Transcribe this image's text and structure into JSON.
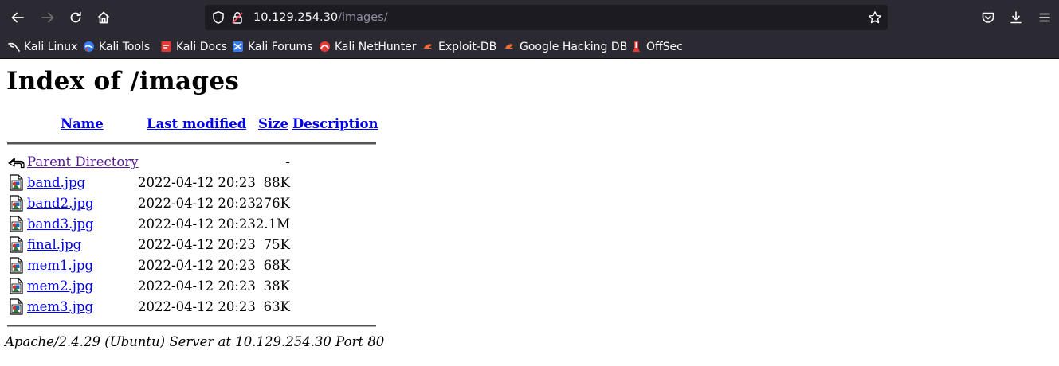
{
  "browser": {
    "url_host": "10.129.254.30",
    "url_path": "/images/",
    "bookmarks": [
      {
        "label": "Kali Linux",
        "icon": "kali-dragon-icon"
      },
      {
        "label": "Kali Tools",
        "icon": "kali-tools-icon"
      },
      {
        "label": "Kali Docs",
        "icon": "kali-docs-icon"
      },
      {
        "label": "Kali Forums",
        "icon": "kali-forums-icon"
      },
      {
        "label": "Kali NetHunter",
        "icon": "nethunter-icon"
      },
      {
        "label": "Exploit-DB",
        "icon": "exploit-db-icon"
      },
      {
        "label": "Google Hacking DB",
        "icon": "ghdb-icon"
      },
      {
        "label": "OffSec",
        "icon": "offsec-icon"
      }
    ]
  },
  "page": {
    "title": "Index of /images",
    "columns": {
      "name": "Name",
      "last_modified": "Last modified",
      "size": "Size",
      "description": "Description"
    },
    "parent": {
      "name": "Parent Directory",
      "size": "-"
    },
    "files": [
      {
        "name": "band.jpg",
        "modified": "2022-04-12 20:23",
        "size": "88K"
      },
      {
        "name": "band2.jpg",
        "modified": "2022-04-12 20:23",
        "size": "276K"
      },
      {
        "name": "band3.jpg",
        "modified": "2022-04-12 20:23",
        "size": "2.1M"
      },
      {
        "name": "final.jpg",
        "modified": "2022-04-12 20:23",
        "size": "75K"
      },
      {
        "name": "mem1.jpg",
        "modified": "2022-04-12 20:23",
        "size": "68K"
      },
      {
        "name": "mem2.jpg",
        "modified": "2022-04-12 20:23",
        "size": "38K"
      },
      {
        "name": "mem3.jpg",
        "modified": "2022-04-12 20:23",
        "size": "63K"
      }
    ],
    "footer": "Apache/2.4.29 (Ubuntu) Server at 10.129.254.30 Port 80"
  }
}
